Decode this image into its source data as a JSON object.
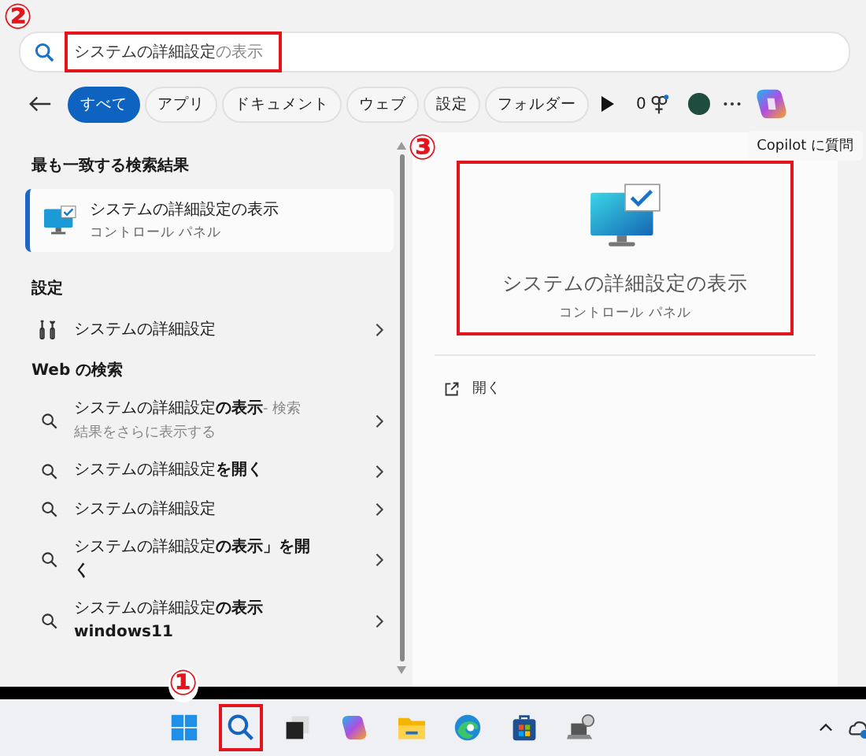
{
  "search": {
    "marker": "②",
    "highlighted": true,
    "value": "システムの詳細設定",
    "suggestion": "の表示"
  },
  "filters": [
    {
      "label": "すべて",
      "selected": true
    },
    {
      "label": "アプリ",
      "selected": false
    },
    {
      "label": "ドキュメント",
      "selected": false
    },
    {
      "label": "ウェブ",
      "selected": false
    },
    {
      "label": "設定",
      "selected": false
    },
    {
      "label": "フォルダー",
      "selected": false
    }
  ],
  "points": "0",
  "tooltip": "Copilot に質問",
  "best_match": {
    "heading": "最も一致する検索結果",
    "title": "システムの詳細設定の表示",
    "subtitle": "コントロール パネル",
    "selected": true
  },
  "settings": {
    "heading": "設定",
    "items": [
      {
        "title": "システムの詳細設定"
      }
    ]
  },
  "web": {
    "heading": "Web の検索",
    "items": [
      {
        "text": "システムの詳細設定**の表示**",
        "note": "- 検索結果をさらに表示する"
      },
      {
        "text": "システムの詳細設定**を開く**"
      },
      {
        "text": "システムの詳細設定"
      },
      {
        "text": "システムの詳細設定**の表示」を開く**"
      },
      {
        "text": "システムの詳細設定**の表示 windows11**"
      }
    ]
  },
  "preview": {
    "marker": "③",
    "highlighted": true,
    "title": "システムの詳細設定の表示",
    "subtitle": "コントロール パネル",
    "actions": [
      {
        "label": "開く"
      }
    ]
  },
  "taskbar": {
    "marker": "①",
    "apps": [
      {
        "kind": "start",
        "highlighted": false
      },
      {
        "kind": "search",
        "highlighted": true
      },
      {
        "kind": "taskview",
        "highlighted": false
      },
      {
        "kind": "copilot",
        "highlighted": false
      },
      {
        "kind": "explorer",
        "highlighted": false
      },
      {
        "kind": "edge",
        "highlighted": false
      },
      {
        "kind": "store",
        "highlighted": false
      },
      {
        "kind": "remote",
        "highlighted": false
      }
    ]
  }
}
